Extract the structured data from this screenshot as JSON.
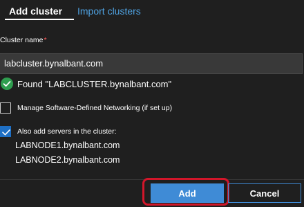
{
  "tabs": [
    {
      "label": "Add cluster",
      "active": true
    },
    {
      "label": "Import clusters",
      "active": false
    }
  ],
  "form": {
    "cluster_name_label": "Cluster name",
    "required_marker": "*",
    "cluster_name_value": "labcluster.bynalbant.com",
    "found_message": "Found \"LABCLUSTER.bynalbant.com\"",
    "manage_sdn_label": "Manage Software-Defined Networking (if set up)",
    "manage_sdn_checked": false,
    "add_servers_label": "Also add servers in the cluster:",
    "add_servers_checked": true,
    "servers": [
      "LABNODE1.bynalbant.com",
      "LABNODE2.bynalbant.com"
    ]
  },
  "footer": {
    "add_label": "Add",
    "cancel_label": "Cancel"
  },
  "colors": {
    "accent": "#3f8bd6",
    "success": "#2f9e4f",
    "highlight": "#d2162a",
    "required": "#ff5c5c"
  },
  "icons": {
    "found": "check-circle-icon",
    "checkbox": "checkmark-icon"
  }
}
